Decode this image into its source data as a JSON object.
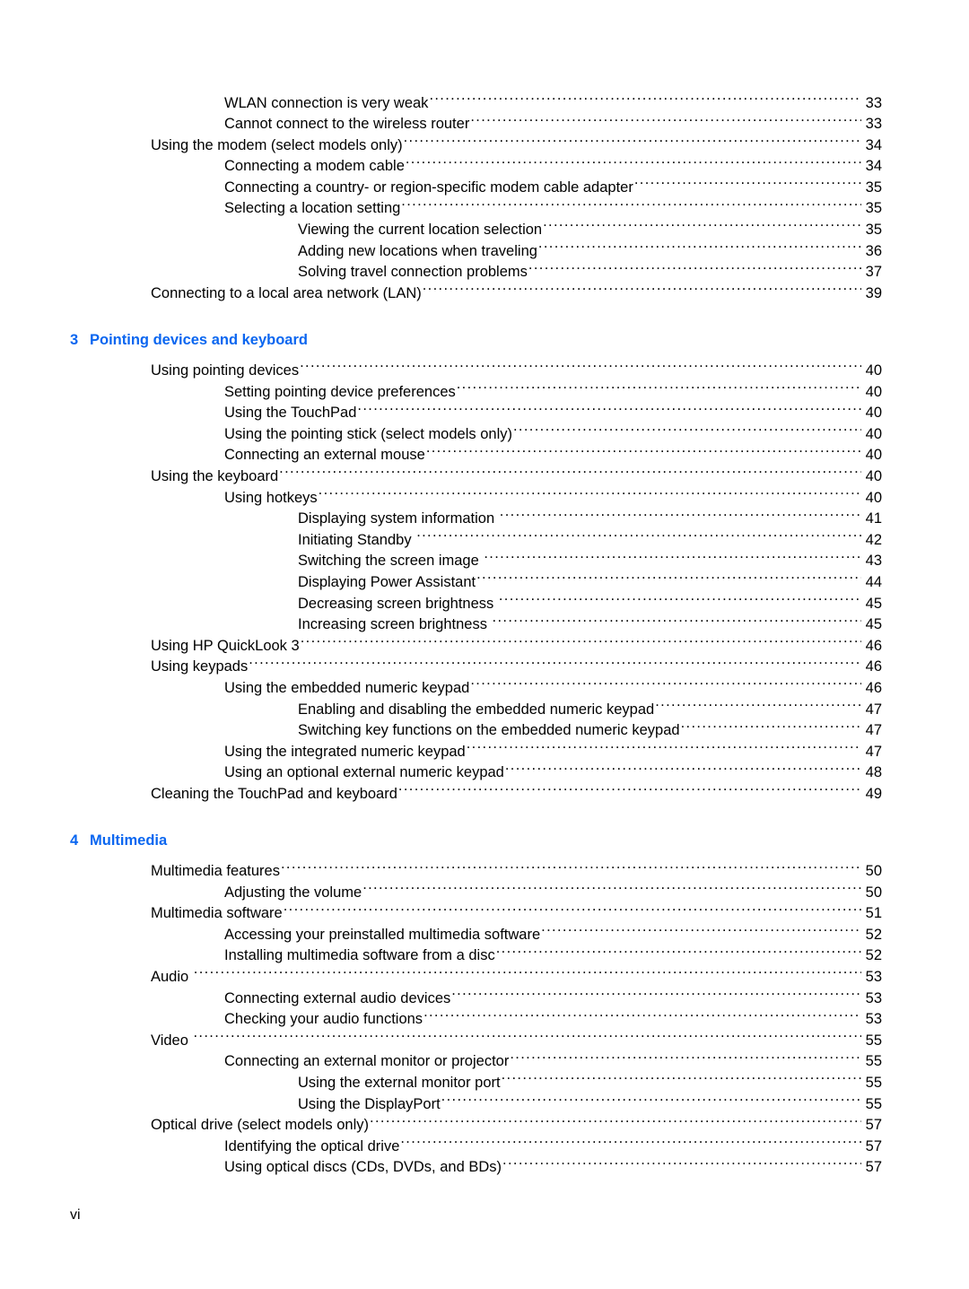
{
  "document": {
    "type": "table-of-contents",
    "footer_page_label": "vi",
    "heading_color": "#0a66f0",
    "text_color": "#000000"
  },
  "blocks": [
    {
      "kind": "entries",
      "entries": [
        {
          "title": "WLAN connection is very weak",
          "page": "33",
          "level": 1,
          "space_before_leader": false
        },
        {
          "title": "Cannot connect to the wireless router",
          "page": "33",
          "level": 1,
          "space_before_leader": false
        },
        {
          "title": "Using the modem (select models only)",
          "page": "34",
          "level": 0,
          "space_before_leader": false
        },
        {
          "title": "Connecting a modem cable",
          "page": "34",
          "level": 1,
          "space_before_leader": false
        },
        {
          "title": "Connecting a country- or region-specific modem cable adapter",
          "page": "35",
          "level": 1,
          "space_before_leader": false
        },
        {
          "title": "Selecting a location setting",
          "page": "35",
          "level": 1,
          "space_before_leader": false
        },
        {
          "title": "Viewing the current location selection",
          "page": "35",
          "level": 2,
          "space_before_leader": false
        },
        {
          "title": "Adding new locations when traveling",
          "page": "36",
          "level": 2,
          "space_before_leader": false
        },
        {
          "title": "Solving travel connection problems",
          "page": "37",
          "level": 2,
          "space_before_leader": false
        },
        {
          "title": "Connecting to a local area network (LAN)",
          "page": "39",
          "level": 0,
          "space_before_leader": false
        }
      ]
    },
    {
      "kind": "chapter",
      "number": "3",
      "label": "Pointing devices and keyboard"
    },
    {
      "kind": "entries",
      "entries": [
        {
          "title": "Using pointing devices",
          "page": "40",
          "level": 0,
          "space_before_leader": false
        },
        {
          "title": "Setting pointing device preferences",
          "page": "40",
          "level": 1,
          "space_before_leader": false
        },
        {
          "title": "Using the TouchPad",
          "page": "40",
          "level": 1,
          "space_before_leader": false
        },
        {
          "title": "Using the pointing stick (select models only)",
          "page": "40",
          "level": 1,
          "space_before_leader": false
        },
        {
          "title": "Connecting an external mouse",
          "page": "40",
          "level": 1,
          "space_before_leader": false
        },
        {
          "title": "Using the keyboard",
          "page": "40",
          "level": 0,
          "space_before_leader": false
        },
        {
          "title": "Using hotkeys",
          "page": "40",
          "level": 1,
          "space_before_leader": false
        },
        {
          "title": "Displaying system information",
          "page": "41",
          "level": 2,
          "space_before_leader": true
        },
        {
          "title": "Initiating Standby",
          "page": "42",
          "level": 2,
          "space_before_leader": true
        },
        {
          "title": "Switching the screen image",
          "page": "43",
          "level": 2,
          "space_before_leader": true
        },
        {
          "title": "Displaying Power Assistant",
          "page": "44",
          "level": 2,
          "space_before_leader": false
        },
        {
          "title": "Decreasing screen brightness",
          "page": "45",
          "level": 2,
          "space_before_leader": true
        },
        {
          "title": "Increasing screen brightness",
          "page": "45",
          "level": 2,
          "space_before_leader": true
        },
        {
          "title": "Using HP QuickLook 3",
          "page": "46",
          "level": 0,
          "space_before_leader": false
        },
        {
          "title": "Using keypads",
          "page": "46",
          "level": 0,
          "space_before_leader": false
        },
        {
          "title": "Using the embedded numeric keypad",
          "page": "46",
          "level": 1,
          "space_before_leader": false
        },
        {
          "title": "Enabling and disabling the embedded numeric keypad",
          "page": "47",
          "level": 2,
          "space_before_leader": false
        },
        {
          "title": "Switching key functions on the embedded numeric keypad",
          "page": "47",
          "level": 2,
          "space_before_leader": false
        },
        {
          "title": "Using the integrated numeric keypad",
          "page": "47",
          "level": 1,
          "space_before_leader": false
        },
        {
          "title": "Using an optional external numeric keypad",
          "page": "48",
          "level": 1,
          "space_before_leader": false
        },
        {
          "title": "Cleaning the TouchPad and keyboard",
          "page": "49",
          "level": 0,
          "space_before_leader": false
        }
      ]
    },
    {
      "kind": "chapter",
      "number": "4",
      "label": "Multimedia"
    },
    {
      "kind": "entries",
      "entries": [
        {
          "title": "Multimedia features",
          "page": "50",
          "level": 0,
          "space_before_leader": false
        },
        {
          "title": "Adjusting the volume",
          "page": "50",
          "level": 1,
          "space_before_leader": false
        },
        {
          "title": "Multimedia software",
          "page": "51",
          "level": 0,
          "space_before_leader": false
        },
        {
          "title": "Accessing your preinstalled multimedia software",
          "page": "52",
          "level": 1,
          "space_before_leader": false
        },
        {
          "title": "Installing multimedia software from a disc",
          "page": "52",
          "level": 1,
          "space_before_leader": false
        },
        {
          "title": "Audio",
          "page": "53",
          "level": 0,
          "space_before_leader": true
        },
        {
          "title": "Connecting external audio devices",
          "page": "53",
          "level": 1,
          "space_before_leader": false
        },
        {
          "title": "Checking your audio functions",
          "page": "53",
          "level": 1,
          "space_before_leader": false
        },
        {
          "title": "Video",
          "page": "55",
          "level": 0,
          "space_before_leader": true
        },
        {
          "title": "Connecting an external monitor or projector",
          "page": "55",
          "level": 1,
          "space_before_leader": false
        },
        {
          "title": "Using the external monitor port",
          "page": "55",
          "level": 2,
          "space_before_leader": false
        },
        {
          "title": "Using the DisplayPort",
          "page": "55",
          "level": 2,
          "space_before_leader": false
        },
        {
          "title": "Optical drive (select models only)",
          "page": "57",
          "level": 0,
          "space_before_leader": false
        },
        {
          "title": "Identifying the optical drive",
          "page": "57",
          "level": 1,
          "space_before_leader": false
        },
        {
          "title": "Using optical discs (CDs, DVDs, and BDs)",
          "page": "57",
          "level": 1,
          "space_before_leader": false
        }
      ]
    }
  ]
}
